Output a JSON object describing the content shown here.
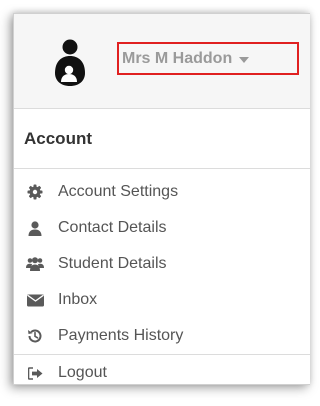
{
  "header": {
    "user_name": "Mrs M Haddon",
    "avatar_icon": "parent-child-icon",
    "dropdown_icon": "caret-down-icon"
  },
  "menu": {
    "section_title": "Account",
    "items": [
      {
        "label": "Account Settings",
        "icon": "gear-icon"
      },
      {
        "label": "Contact Details",
        "icon": "user-icon"
      },
      {
        "label": "Student Details",
        "icon": "users-icon"
      },
      {
        "label": "Inbox",
        "icon": "envelope-icon"
      },
      {
        "label": "Payments History",
        "icon": "history-icon"
      },
      {
        "label": "Logout",
        "icon": "sign-out-icon"
      }
    ]
  },
  "colors": {
    "highlight_border": "#e02020",
    "user_name_text": "#9a9a9a",
    "menu_text": "#555555",
    "icon": "#5a5a5a"
  }
}
